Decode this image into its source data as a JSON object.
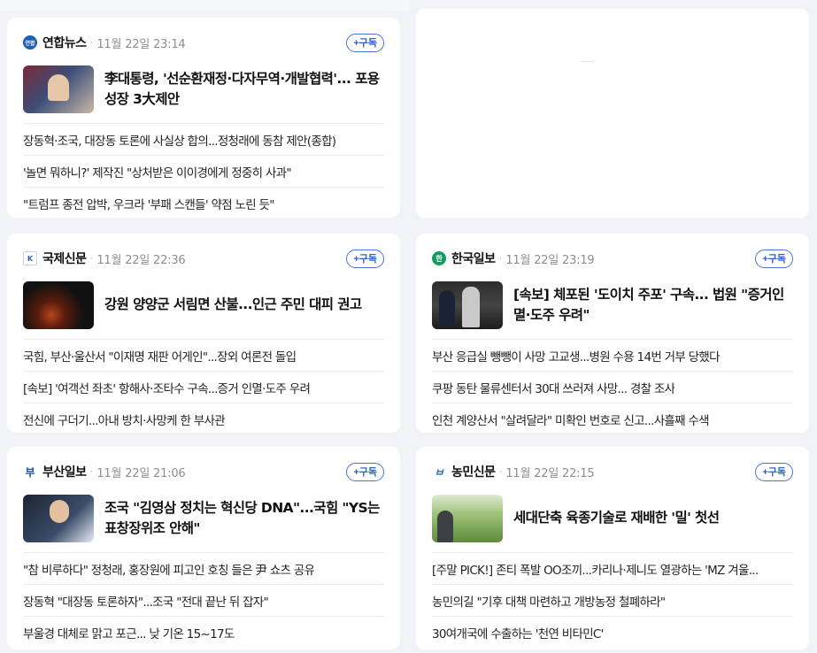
{
  "colors": {
    "accent": "#2f5fcf",
    "background": "#f1f3f6",
    "card": "#ffffff"
  },
  "cards": [
    {
      "press": "연합뉴스",
      "logo_icon": "yonhap-logo-icon",
      "logo_text": "연합",
      "time": "11월 22일 23:14",
      "subscribe": "+구독",
      "headline": "李대통령, '선순환재정·다자무역·개발협력'... 포용성장 3大제안",
      "items": [
        "장동혁·조국, 대장동 토론에 사실상 합의...정청래에 동참 제안(종합)",
        "'놀면 뭐하니?' 제작진 \"상처받은 이이경에게 정중히 사과\"",
        "\"트럼프 종전 압박, 우크라 '부패 스캔들' 약점 노린 듯\""
      ]
    },
    {
      "press": "국제신문",
      "logo_icon": "kukje-logo-icon",
      "logo_text": "K",
      "time": "11월 22일 22:36",
      "subscribe": "+구독",
      "headline": "강원 양양군 서림면 산불...인근 주민 대피 권고",
      "items": [
        "국힘, 부산·울산서 \"이재명 재판 어게인\"...장외 여론전 돌입",
        "[속보] '여객선 좌초' 항해사·조타수 구속...증거 인멸·도주 우려",
        "전신에 구더기...아내 방치·사망케 한 부사관"
      ]
    },
    {
      "press": "한국일보",
      "logo_icon": "hankook-logo-icon",
      "logo_text": "한",
      "time": "11월 22일 23:19",
      "subscribe": "+구독",
      "headline": "[속보] 체포된 '도이치 주포' 구속... 법원 \"증거인멸·도주 우려\"",
      "items": [
        "부산 응급실 뺑뺑이 사망 고교생...병원 수용 14번 거부 당했다",
        "쿠팡 동탄 물류센터서 30대 쓰러져 사망... 경찰 조사",
        "인천 계양산서 \"살려달라\" 미확인 번호로 신고...사흘째 수색"
      ]
    },
    {
      "press": "부산일보",
      "logo_icon": "busan-logo-icon",
      "logo_text": "부",
      "time": "11월 22일 21:06",
      "subscribe": "+구독",
      "headline": "조국 \"김영삼 정치는 혁신당 DNA\"...국힘 \"YS는 표창장위조 안해\"",
      "items": [
        "\"참 비루하다\" 정청래, 홍장원에 피고인 호칭 들은 尹 쇼츠 공유",
        "장동혁 \"대장동 토론하자\"...조국 \"전대 끝난 뒤 잡자\"",
        "부울경 대체로 맑고 포근... 낮 기온 15~17도"
      ]
    },
    {
      "press": "농민신문",
      "logo_icon": "nongmin-logo-icon",
      "logo_text": "ㅂ",
      "time": "11월 22일 22:15",
      "subscribe": "+구독",
      "headline": "세대단축 육종기술로 재배한 '밀' 첫선",
      "items": [
        "[주말 PICK!] 존티 폭발 OO조끼...카리나·제니도 열광하는 'MZ 겨울...",
        "농민의길 \"기후 대책 마련하고 개방농정 철폐하라\"",
        "30여개국에 수출하는 '천연 비타민C'"
      ]
    }
  ]
}
